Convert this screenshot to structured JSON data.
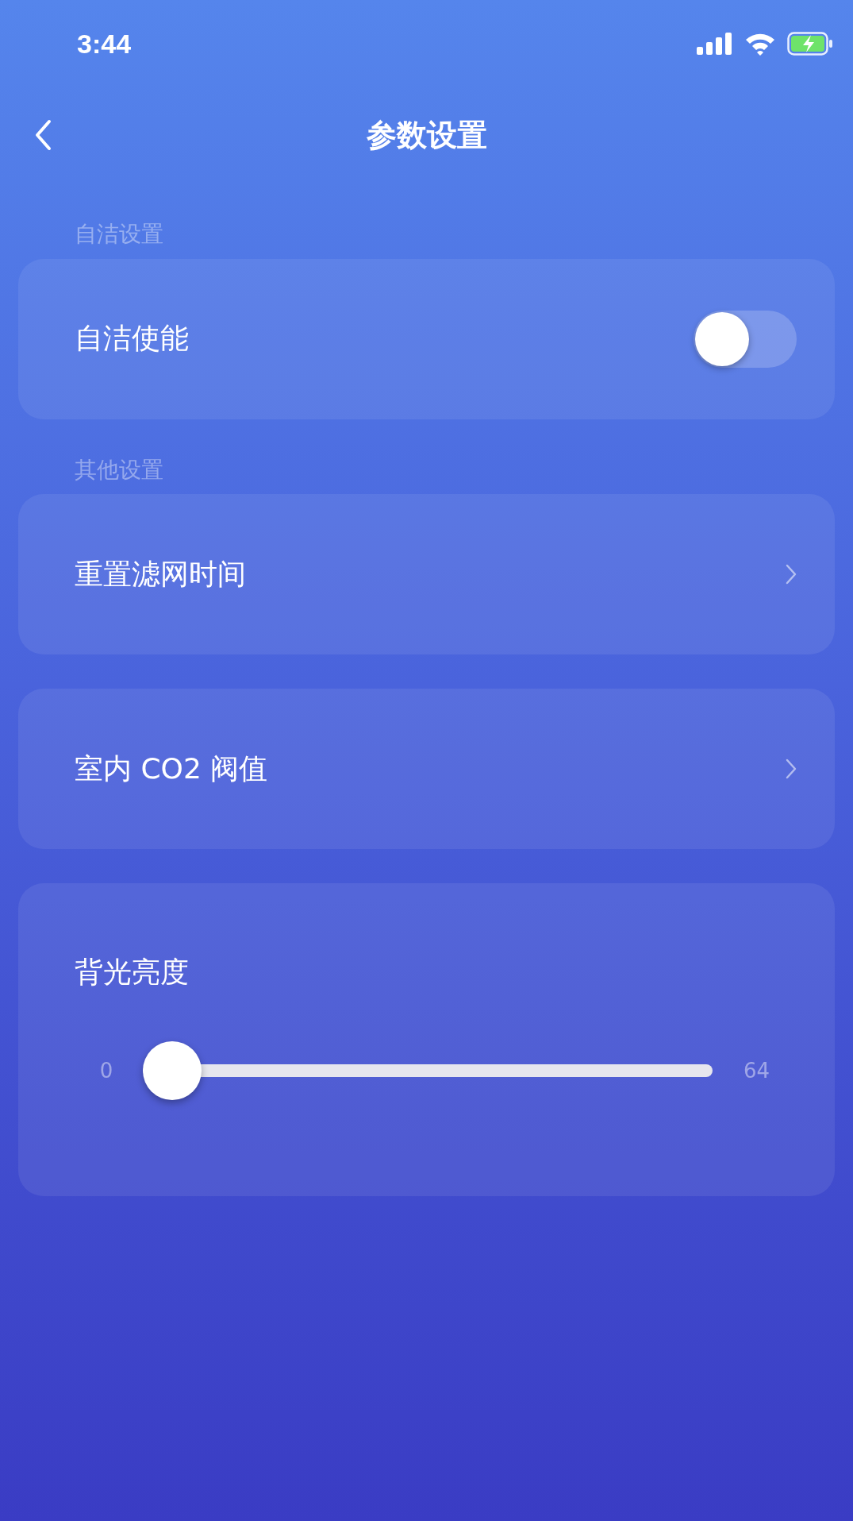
{
  "status_bar": {
    "time": "3:44"
  },
  "nav": {
    "title": "参数设置"
  },
  "sections": [
    {
      "header": "自洁设置",
      "cards": [
        {
          "kind": "toggle",
          "label": "自洁使能",
          "on": false
        }
      ]
    },
    {
      "header": "其他设置",
      "cards": [
        {
          "kind": "link",
          "label": "重置滤网时间"
        },
        {
          "kind": "link",
          "label": "室内 CO2 阀值"
        },
        {
          "kind": "slider",
          "label": "背光亮度",
          "min": "0",
          "max": "64",
          "level": 0
        }
      ]
    }
  ]
}
